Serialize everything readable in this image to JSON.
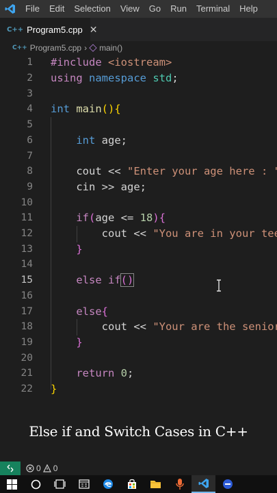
{
  "menu": {
    "items": [
      "File",
      "Edit",
      "Selection",
      "View",
      "Go",
      "Run",
      "Terminal",
      "Help"
    ]
  },
  "tab": {
    "file_type": "C++",
    "label": "Program5.cpp",
    "close": "✕"
  },
  "breadcrumb": {
    "file": "Program5.cpp",
    "symbol": "main()"
  },
  "editor": {
    "active_line": 15,
    "line_numbers": [
      "1",
      "2",
      "3",
      "4",
      "5",
      "6",
      "7",
      "8",
      "9",
      "10",
      "11",
      "12",
      "13",
      "14",
      "15",
      "16",
      "17",
      "18",
      "19",
      "20",
      "21",
      "22"
    ],
    "lines": [
      "#include <iostream>",
      "using namespace std;",
      "",
      "int main(){",
      "",
      "    int age;",
      "",
      "    cout << \"Enter your age here : \"",
      "    cin >> age;",
      "",
      "    if(age <= 18){",
      "        cout << \"You are in your tee",
      "    }",
      "",
      "    else if()",
      "",
      "    else{",
      "        cout << \"Your are the senior",
      "    }",
      "",
      "    return 0;",
      "}"
    ]
  },
  "caption": "Else if and Switch Cases in C++",
  "status": {
    "remote_icon": "remote-icon",
    "errors": "0",
    "warnings": "0"
  },
  "colors": {
    "keyword": "#569cd6",
    "control": "#c586c0",
    "string": "#ce9178",
    "number": "#b5cea8",
    "function": "#dcdcaa",
    "namespace": "#4ec9b0",
    "accent": "#007acc"
  }
}
